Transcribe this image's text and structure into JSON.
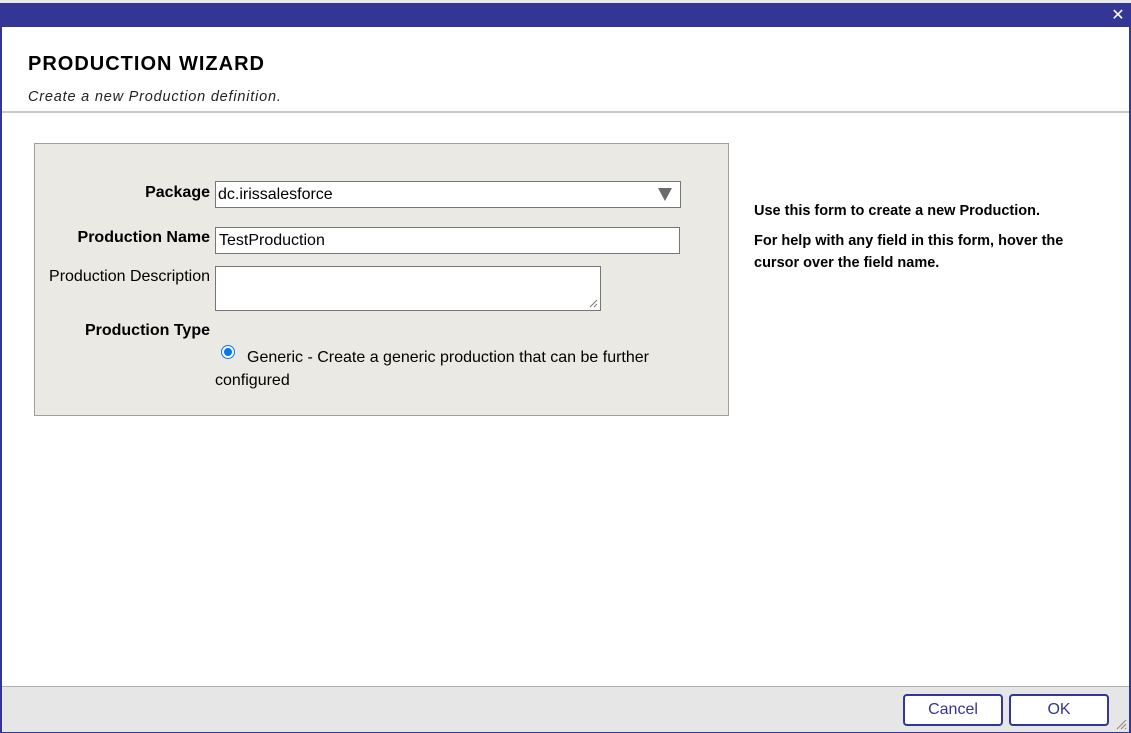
{
  "window": {
    "close_symbol": "✕"
  },
  "header": {
    "title": "PRODUCTION WIZARD",
    "subtitle": "Create a new Production definition."
  },
  "form": {
    "package_label": "Package",
    "package_value": "dc.irissalesforce",
    "name_label": "Production Name",
    "name_value": "TestProduction",
    "description_label": "Production Description",
    "description_value": "",
    "type_label": "Production Type",
    "type_option": "Generic - Create a generic production that can be further configured"
  },
  "help": {
    "line1": "Use this form to create a new Production.",
    "line2": "For help with any field in this form, hover the cursor over the field name."
  },
  "footer": {
    "cancel_label": "Cancel",
    "ok_label": "OK"
  },
  "colors": {
    "accent": "#333695",
    "panel_bg": "#ebe9e4",
    "radio": "#0075ff"
  }
}
